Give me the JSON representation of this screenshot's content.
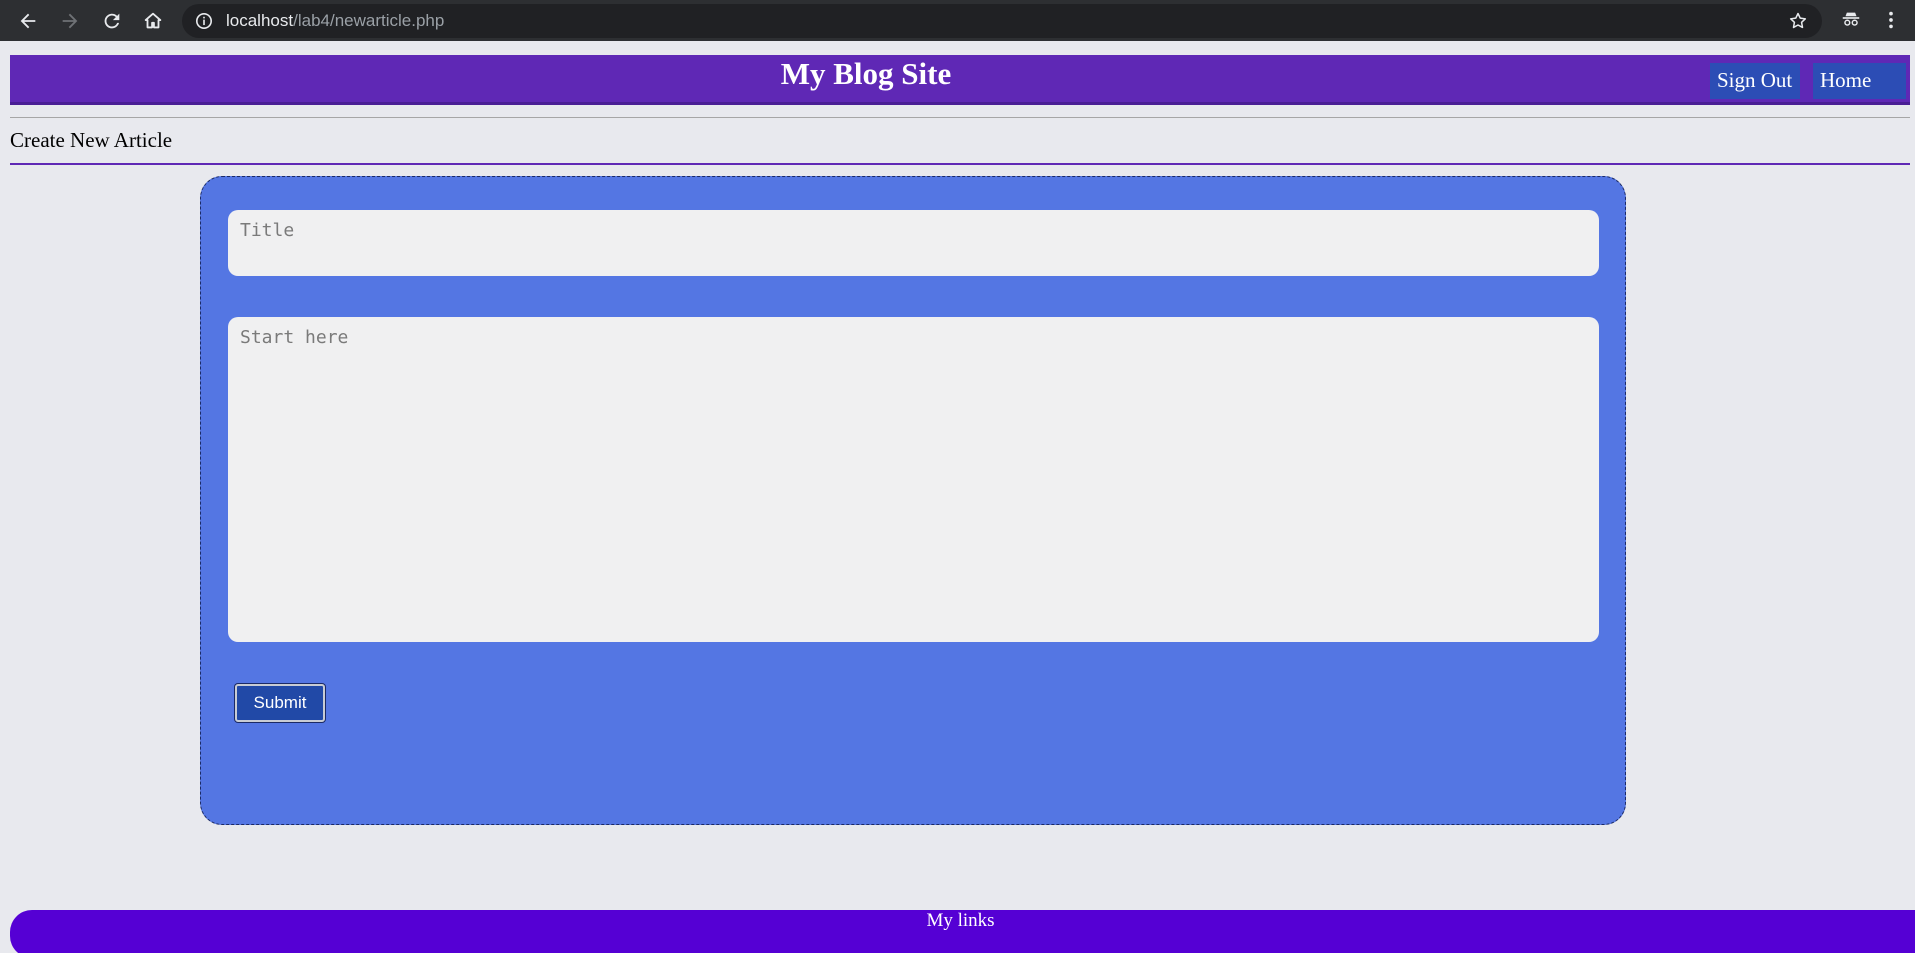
{
  "browser": {
    "url_host": "localhost",
    "url_path": "/lab4/newarticle.php"
  },
  "header": {
    "site_title": "My Blog Site",
    "nav": [
      {
        "label": "Sign Out"
      },
      {
        "label": "Home"
      }
    ]
  },
  "page": {
    "heading": "Create New Article"
  },
  "form": {
    "title_placeholder": "Title",
    "body_placeholder": "Start here",
    "submit_label": "Submit"
  },
  "footer": {
    "label": "My links"
  },
  "colors": {
    "header_bg": "#5f28b5",
    "nav_button_bg": "#2c4db5",
    "form_bg": "#5476e3",
    "submit_bg": "#2149a7",
    "footer_bg": "#5500d4",
    "page_bg": "#e8e9ee"
  }
}
